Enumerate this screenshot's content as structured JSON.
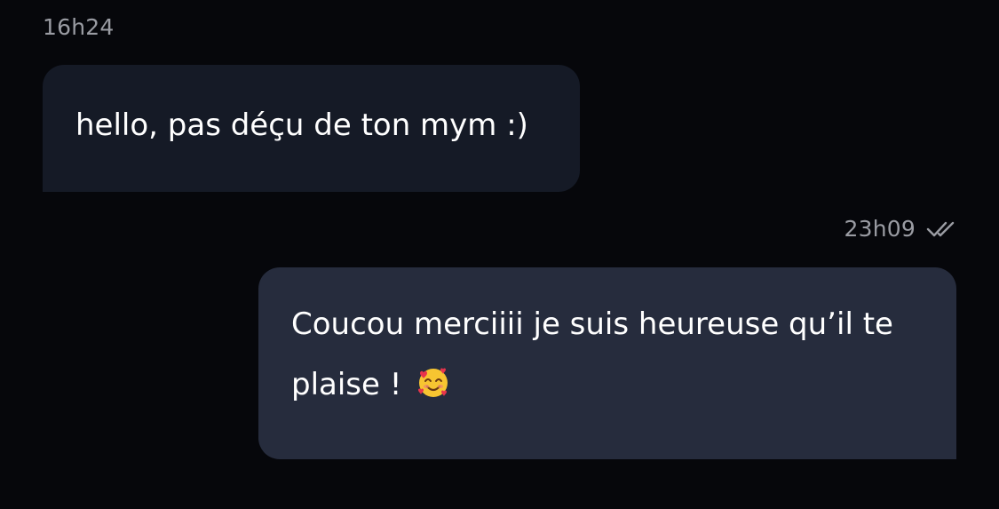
{
  "conversation": {
    "messages": [
      {
        "direction": "incoming",
        "time": "16h24",
        "text": "hello, pas déçu de ton mym :)"
      },
      {
        "direction": "outgoing",
        "time": "23h09",
        "status_icon": "double-check-icon",
        "text": "Coucou merciiii je suis heureuse qu’il te plaise !",
        "emoji": "smiling-face-with-hearts"
      }
    ]
  },
  "colors": {
    "background": "#06070b",
    "incoming_bubble": "#151a26",
    "outgoing_bubble": "#262c3d",
    "timestamp": "#9a9ca3",
    "text": "#ffffff"
  }
}
